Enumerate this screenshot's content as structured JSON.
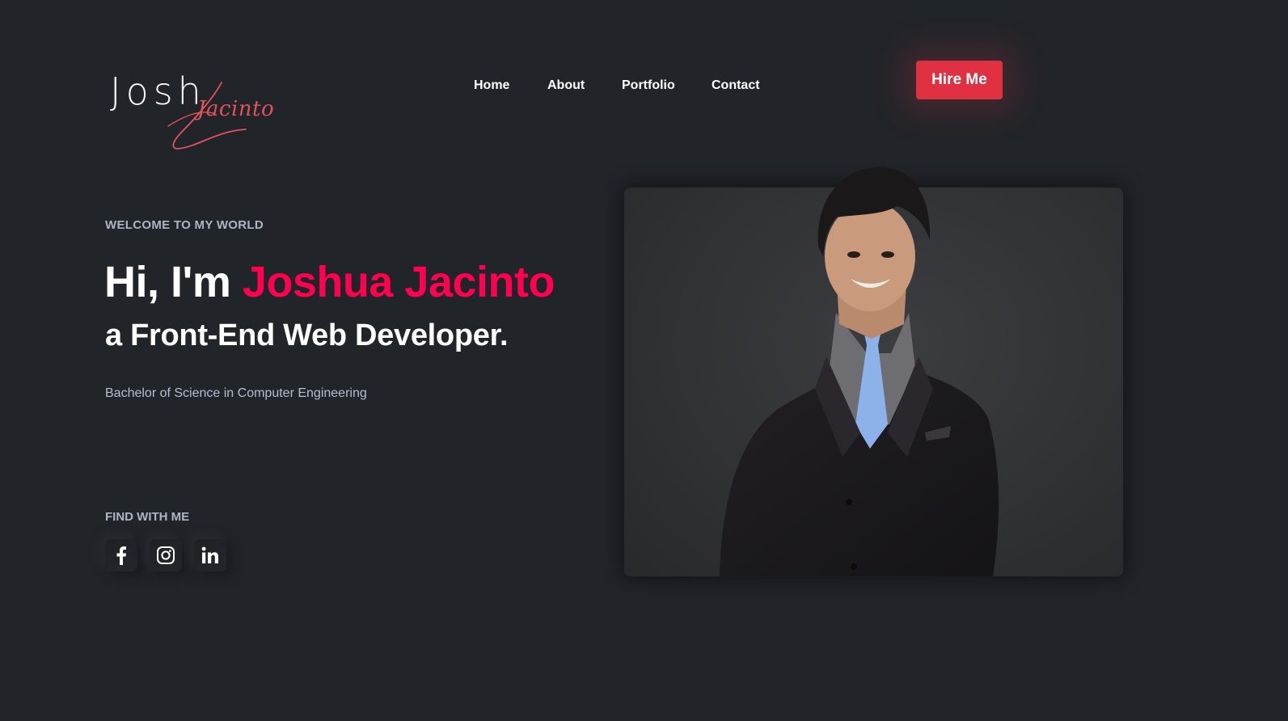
{
  "logo": {
    "main_text": "Josh",
    "script_text": "Jacinto"
  },
  "nav": {
    "items": [
      {
        "label": "Home"
      },
      {
        "label": "About"
      },
      {
        "label": "Portfolio"
      },
      {
        "label": "Contact"
      }
    ]
  },
  "header": {
    "hire_label": "Hire Me"
  },
  "hero": {
    "welcome": "WELCOME TO MY WORLD",
    "greeting": "Hi, I'm ",
    "name": "Joshua Jacinto",
    "role": "a Front-End Web Developer.",
    "degree": "Bachelor of Science in Computer Engineering"
  },
  "socials": {
    "label": "FIND WITH ME",
    "items": [
      {
        "icon": "facebook-icon"
      },
      {
        "icon": "instagram-icon"
      },
      {
        "icon": "linkedin-icon"
      }
    ]
  },
  "colors": {
    "background": "#212429",
    "accent": "#ff014f",
    "hire_button": "#e03143",
    "muted_text": "#c4cfde",
    "logo_script": "#e0535c"
  }
}
